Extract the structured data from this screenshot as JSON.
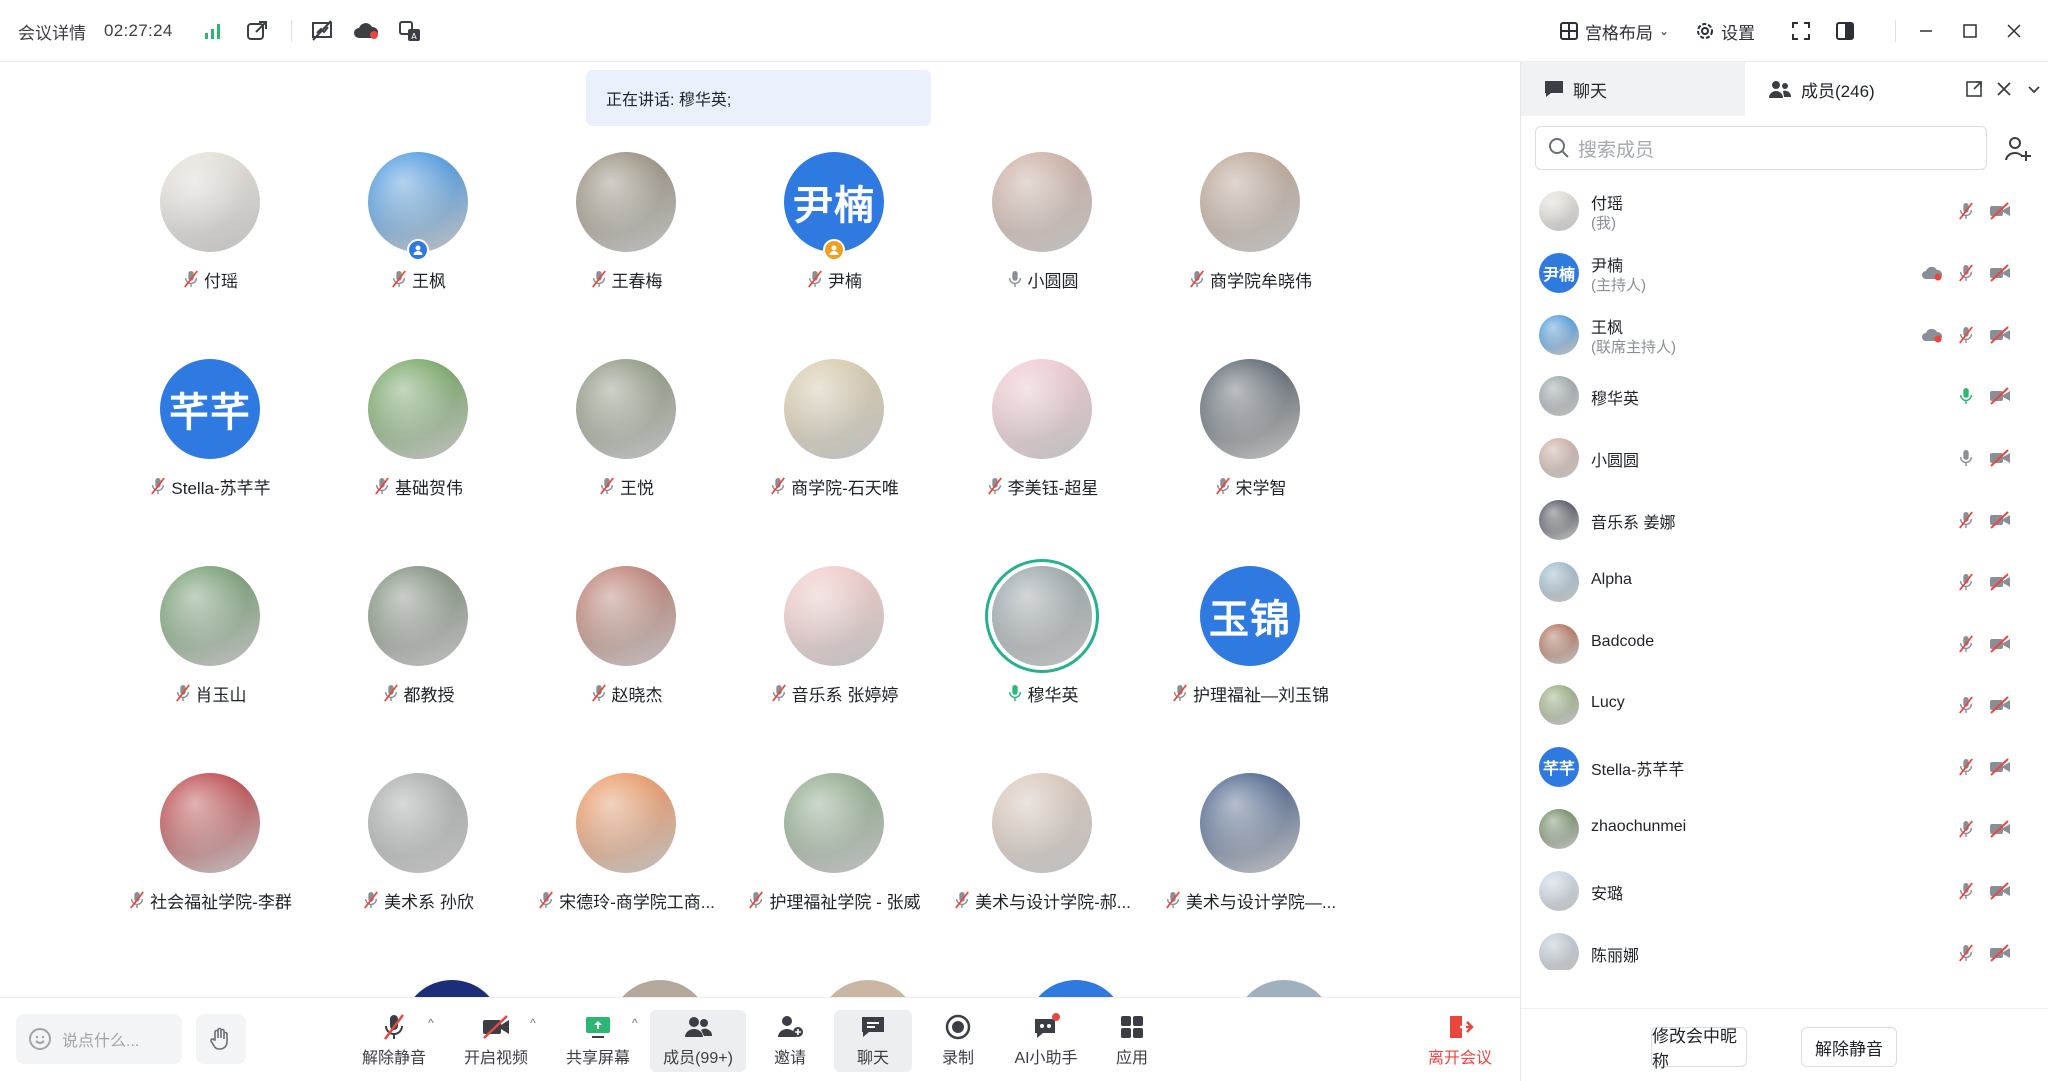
{
  "topbar": {
    "meeting_details": "会议详情",
    "timer": "02:27:24",
    "layout_label": "宫格布局",
    "settings_label": "设置"
  },
  "speaking": "正在讲话: 穆华英;",
  "tiles": [
    {
      "name": "付瑶",
      "mic": "muted",
      "avatar": "photo-doll",
      "color": "#e7e1d8"
    },
    {
      "name": "王枫",
      "mic": "muted",
      "avatar": "photo-doraemon",
      "color": "#2b8ce4",
      "badge": "co-host"
    },
    {
      "name": "王春梅",
      "mic": "muted",
      "avatar": "photo-woman",
      "color": "#8a7f6a"
    },
    {
      "name": "尹楠",
      "mic": "muted",
      "avatar": "text",
      "avatar_text": "尹楠",
      "badge": "host"
    },
    {
      "name": "小圆圆",
      "mic": "on",
      "avatar": "photo-girl",
      "color": "#c9a799"
    },
    {
      "name": "商学院牟晓伟",
      "mic": "muted",
      "avatar": "photo-rocks",
      "color": "#b59a86"
    },
    {
      "name": "Stella-苏芊芊",
      "mic": "muted",
      "avatar": "text",
      "avatar_text": "芊芊"
    },
    {
      "name": "基础贺伟",
      "mic": "muted",
      "avatar": "photo-lotus",
      "color": "#5f9b4a"
    },
    {
      "name": "王悦",
      "mic": "muted",
      "avatar": "photo-village",
      "color": "#7c8a6e"
    },
    {
      "name": "商学院-石天唯",
      "mic": "muted",
      "avatar": "photo-cat",
      "color": "#d8c9a4"
    },
    {
      "name": "李美钰-超星",
      "mic": "muted",
      "avatar": "photo-kitty",
      "color": "#f4c7cf"
    },
    {
      "name": "宋学智",
      "mic": "muted",
      "avatar": "photo-red",
      "color": "#3e4a55"
    },
    {
      "name": "肖玉山",
      "mic": "muted",
      "avatar": "photo-lake",
      "color": "#5d8f5a"
    },
    {
      "name": "都教授",
      "mic": "muted",
      "avatar": "photo-man",
      "color": "#6d7f6a"
    },
    {
      "name": "赵晓杰",
      "mic": "muted",
      "avatar": "photo-flowers",
      "color": "#b56a5a"
    },
    {
      "name": "音乐系 张婷婷",
      "mic": "muted",
      "avatar": "photo-pink",
      "color": "#f6c9c6"
    },
    {
      "name": "穆华英",
      "mic": "speaking",
      "avatar": "photo-street",
      "color": "#8d9aa0",
      "ring": true
    },
    {
      "name": "护理福祉—刘玉锦",
      "mic": "muted",
      "avatar": "text",
      "avatar_text": "玉锦"
    },
    {
      "name": "社会福祉学院-李群",
      "mic": "muted",
      "avatar": "photo-seal",
      "color": "#b7262b"
    },
    {
      "name": "美术系 孙欣",
      "mic": "muted",
      "avatar": "photo-stone",
      "color": "#9ea3a0"
    },
    {
      "name": "宋德玲-商学院工商...",
      "mic": "muted",
      "avatar": "photo-orange",
      "color": "#f08a4a"
    },
    {
      "name": "护理福祉学院 - 张威",
      "mic": "muted",
      "avatar": "photo-garden",
      "color": "#7ea07a"
    },
    {
      "name": "美术与设计学院-郝...",
      "mic": "muted",
      "avatar": "photo-portrait",
      "color": "#d9c4b4"
    },
    {
      "name": "美术与设计学院—...",
      "mic": "muted",
      "avatar": "photo-starry",
      "color": "#2c4a7c"
    }
  ],
  "bottombar": {
    "say_placeholder": "说点什么...",
    "unmute": "解除静音",
    "start_video": "开启视频",
    "share_screen": "共享屏幕",
    "members": "成员(99+)",
    "invite": "邀请",
    "chat": "聊天",
    "record": "录制",
    "ai_assistant": "AI小助手",
    "apps": "应用",
    "leave": "离开会议"
  },
  "panel": {
    "chat_tab": "聊天",
    "members_tab": "成员(246)",
    "search_placeholder": "搜索成员",
    "rename_button": "修改会中昵称",
    "unmute_button": "解除静音",
    "members": [
      {
        "name": "付瑶",
        "role": "(我)",
        "mic": "muted",
        "avatar": "photo-doll",
        "color": "#e7e1d8"
      },
      {
        "name": "尹楠",
        "role": "(主持人)",
        "mic": "muted",
        "avatar": "text",
        "avatar_text": "尹楠",
        "cloud": true
      },
      {
        "name": "王枫",
        "role": "(联席主持人)",
        "mic": "muted",
        "avatar": "photo-doraemon",
        "color": "#2b8ce4",
        "cloud": true
      },
      {
        "name": "穆华英",
        "role": "",
        "mic": "speaking",
        "avatar": "photo-street",
        "color": "#8d9aa0"
      },
      {
        "name": "小圆圆",
        "role": "",
        "mic": "on",
        "avatar": "photo-girl",
        "color": "#c9a799"
      },
      {
        "name": "音乐系    姜娜",
        "role": "",
        "mic": "muted",
        "avatar": "photo-dark",
        "color": "#2f3440"
      },
      {
        "name": "Alpha",
        "role": "",
        "mic": "muted",
        "avatar": "photo-sky",
        "color": "#8fb3c9"
      },
      {
        "name": "Badcode",
        "role": "",
        "mic": "muted",
        "avatar": "photo-panda",
        "color": "#a6573a"
      },
      {
        "name": "Lucy",
        "role": "",
        "mic": "muted",
        "avatar": "photo-field",
        "color": "#8aa36b"
      },
      {
        "name": "Stella-苏芊芊",
        "role": "",
        "mic": "muted",
        "avatar": "text",
        "avatar_text": "芊芊"
      },
      {
        "name": "zhaochunmei",
        "role": "",
        "mic": "muted",
        "avatar": "photo-forest",
        "color": "#5b7a4a"
      },
      {
        "name": "安璐",
        "role": "",
        "mic": "muted",
        "avatar": "photo-beach",
        "color": "#c6d6e6"
      },
      {
        "name": "陈丽娜",
        "role": "",
        "mic": "muted",
        "avatar": "photo-cloud",
        "color": "#b9c6d4"
      }
    ]
  }
}
